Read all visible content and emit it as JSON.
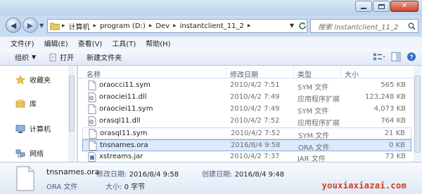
{
  "address": {
    "crumbs": [
      "计算机",
      "program (D:)",
      "Dev",
      "instantclient_11_2"
    ]
  },
  "search": {
    "placeholder": "搜索 instantclient_11_2"
  },
  "menu": [
    "文件(F)",
    "编辑(E)",
    "查看(V)",
    "工具(T)",
    "帮助(H)"
  ],
  "toolbar": {
    "organize": "组织",
    "open": "打开",
    "new_folder": "新建文件夹"
  },
  "nav": {
    "favorites": "收藏夹",
    "libraries": "库",
    "computer": "计算机",
    "network": "网络"
  },
  "columns": {
    "name": "名称",
    "date": "修改日期",
    "type": "类型",
    "size": "大小"
  },
  "files": [
    {
      "name": "oraocci11.sym",
      "date": "2010/4/2 7:51",
      "type": "SYM 文件",
      "size": "565 KB",
      "icon": "generic-file-icon"
    },
    {
      "name": "oraociei11.dll",
      "date": "2010/4/2 7:49",
      "type": "应用程序扩展",
      "size": "123,248 KB",
      "icon": "dll-file-icon"
    },
    {
      "name": "oraociei11.sym",
      "date": "2010/4/2 7:49",
      "type": "SYM 文件",
      "size": "4,073 KB",
      "icon": "generic-file-icon"
    },
    {
      "name": "orasql11.dll",
      "date": "2010/4/2 7:52",
      "type": "应用程序扩展",
      "size": "764 KB",
      "icon": "dll-file-icon"
    },
    {
      "name": "orasql11.sym",
      "date": "2010/4/2 7:52",
      "type": "SYM 文件",
      "size": "21 KB",
      "icon": "generic-file-icon"
    },
    {
      "name": "tnsnames.ora",
      "date": "2016/8/4 9:58",
      "type": "ORA 文件",
      "size": "0 KB",
      "icon": "generic-file-icon"
    },
    {
      "name": "xstreams.jar",
      "date": "2010/4/2 7:37",
      "type": "JAR 文件",
      "size": "73 KB",
      "icon": "jar-file-icon"
    }
  ],
  "details": {
    "name": "tnsnames.ora",
    "type": "ORA 文件",
    "modified_label": "修改日期:",
    "modified": "2016/8/4 9:58",
    "created_label": "创建日期:",
    "created": "2016/8/4 9:48",
    "size_label": "大小:",
    "size": "0 字节"
  },
  "watermark": "youxiaxiazai.com",
  "colors": {
    "selection": "#dceafc",
    "watermark": "#d93a18",
    "accent": "#2a4a78"
  }
}
